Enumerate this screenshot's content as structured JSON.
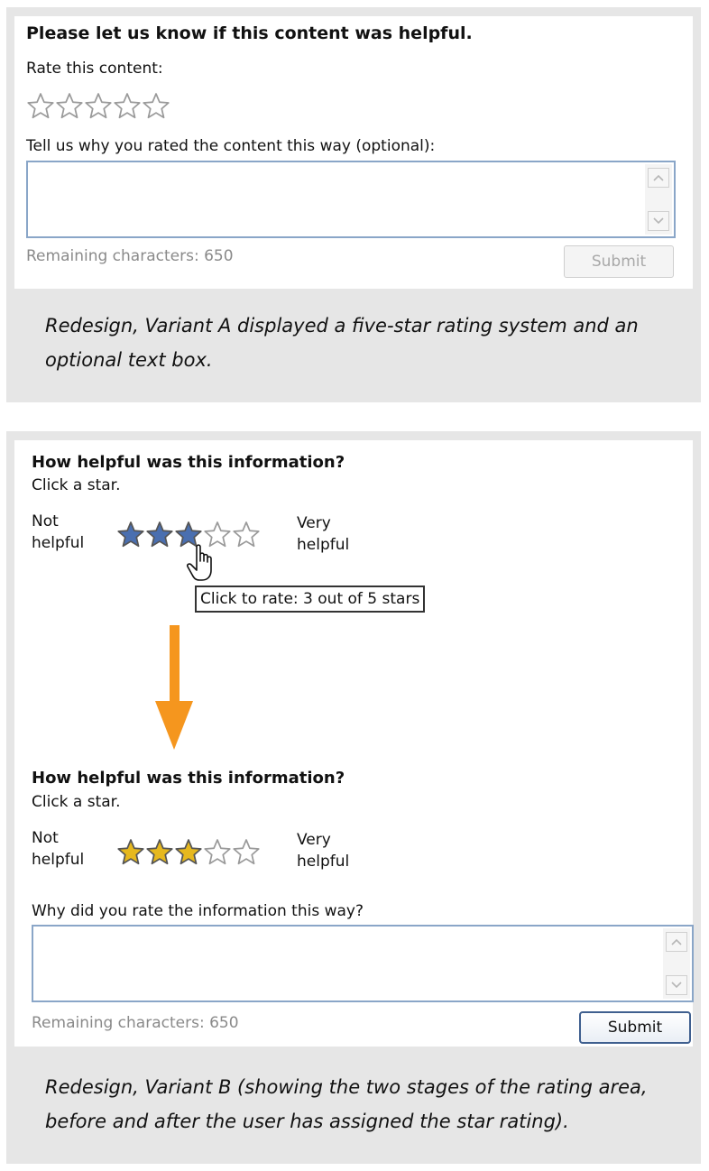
{
  "variant_a": {
    "heading": "Please let us know if this content was helpful.",
    "rate_label": "Rate this content:",
    "rating": 0,
    "star_count": 5,
    "comment_label": "Tell us why you rated the content this way (optional):",
    "comment_value": "",
    "remaining": "Remaining characters: 650",
    "submit_label": "Submit",
    "submit_enabled": false,
    "caption": "Redesign, Variant A displayed a five-star rating system and an optional text box."
  },
  "variant_b": {
    "stage1": {
      "question": "How helpful was this information?",
      "instruction": "Click a star.",
      "low_label_line1": "Not",
      "low_label_line2": "helpful",
      "high_label_line1": "Very",
      "high_label_line2": "helpful",
      "hover_rating": 3,
      "tooltip": "Click to rate: 3 out of 5 stars"
    },
    "stage2": {
      "question": "How helpful was this information?",
      "instruction": "Click a star.",
      "low_label_line1": "Not",
      "low_label_line2": "helpful",
      "high_label_line1": "Very",
      "high_label_line2": "helpful",
      "rating": 3,
      "comment_label": "Why did you rate the information this way?",
      "comment_value": "",
      "remaining": "Remaining characters: 650",
      "submit_label": "Submit",
      "submit_enabled": true
    },
    "caption": "Redesign, Variant B (showing the two stages of the rating area, before and after the user has assigned the star rating)."
  },
  "colors": {
    "panel_bg": "#e6e6e6",
    "star_hover": "#4a6fb0",
    "star_selected": "#e6b81e",
    "star_empty": "#9a9a9a",
    "arrow": "#f5961e",
    "field_border": "#8aa6c8"
  },
  "icons": [
    "star-icon",
    "hand-cursor-icon",
    "down-arrow-icon",
    "scroll-up-icon",
    "scroll-down-icon"
  ]
}
